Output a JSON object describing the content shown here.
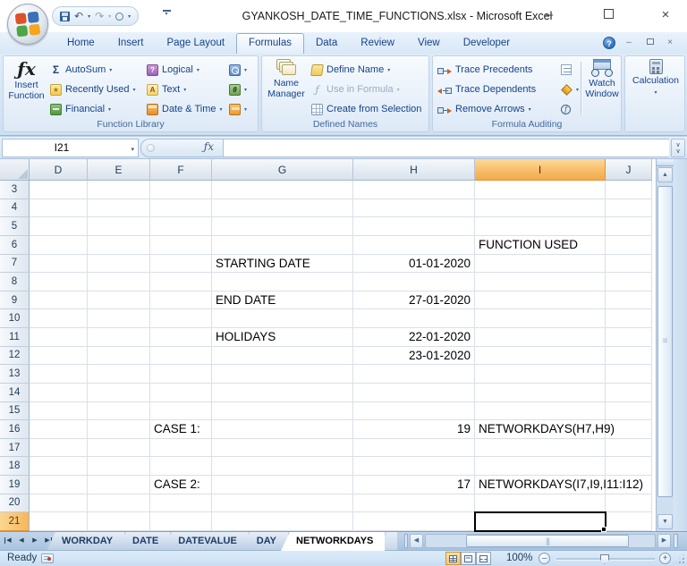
{
  "window": {
    "title": "GYANKOSH_DATE_TIME_FUNCTIONS.xlsx - Microsoft Excel"
  },
  "ribbon": {
    "tabs": [
      "Home",
      "Insert",
      "Page Layout",
      "Formulas",
      "Data",
      "Review",
      "View",
      "Developer"
    ],
    "active_tab": "Formulas",
    "function_library": {
      "label": "Function Library",
      "insert_function_line1": "Insert",
      "insert_function_line2": "Function",
      "autosum": "AutoSum",
      "recently_used": "Recently Used",
      "financial": "Financial",
      "logical": "Logical",
      "text": "Text",
      "date_time": "Date & Time",
      "lookup_reference_icon": "Lookup & Reference",
      "math_trig_icon": "Math & Trig",
      "more_functions_icon": "More Functions"
    },
    "defined_names": {
      "label": "Defined Names",
      "name_manager_line1": "Name",
      "name_manager_line2": "Manager",
      "define_name": "Define Name",
      "use_in_formula": "Use in Formula",
      "create_from_selection": "Create from Selection"
    },
    "formula_auditing": {
      "label": "Formula Auditing",
      "trace_precedents": "Trace Precedents",
      "trace_dependents": "Trace Dependents",
      "remove_arrows": "Remove Arrows",
      "watch_window_line1": "Watch",
      "watch_window_line2": "Window"
    },
    "calculation": {
      "button": "Calculation"
    }
  },
  "formula_bar": {
    "name_box": "I21",
    "formula": ""
  },
  "sheet": {
    "columns": [
      "D",
      "E",
      "F",
      "G",
      "H",
      "I",
      "J"
    ],
    "first_row": 3,
    "last_row": 21,
    "selected_cell": "I21",
    "selected_column": "I",
    "selected_row": 21,
    "cells": [
      {
        "ref": "I6",
        "text": "FUNCTION USED",
        "align": "left"
      },
      {
        "ref": "G7",
        "text": "STARTING DATE",
        "align": "left"
      },
      {
        "ref": "H7",
        "text": "01-01-2020",
        "align": "right"
      },
      {
        "ref": "G9",
        "text": "END DATE",
        "align": "left"
      },
      {
        "ref": "H9",
        "text": "27-01-2020",
        "align": "right"
      },
      {
        "ref": "G11",
        "text": "HOLIDAYS",
        "align": "left"
      },
      {
        "ref": "H11",
        "text": "22-01-2020",
        "align": "right"
      },
      {
        "ref": "H12",
        "text": "23-01-2020",
        "align": "right"
      },
      {
        "ref": "F16",
        "text": "CASE 1:",
        "align": "left"
      },
      {
        "ref": "H16",
        "text": "19",
        "align": "right"
      },
      {
        "ref": "I16",
        "text": "NETWORKDAYS(H7,H9)",
        "align": "left"
      },
      {
        "ref": "F19",
        "text": "CASE 2:",
        "align": "left"
      },
      {
        "ref": "H19",
        "text": "17",
        "align": "right"
      },
      {
        "ref": "I19",
        "text": "NETWORKDAYS(I7,I9,I11:I12)",
        "align": "left"
      }
    ]
  },
  "sheet_tabs": {
    "items": [
      "WORKDAY",
      "DATE",
      "DATEVALUE",
      "DAY",
      "NETWORKDAYS"
    ],
    "active": "NETWORKDAYS"
  },
  "status_bar": {
    "mode": "Ready",
    "zoom_level": "100%"
  }
}
